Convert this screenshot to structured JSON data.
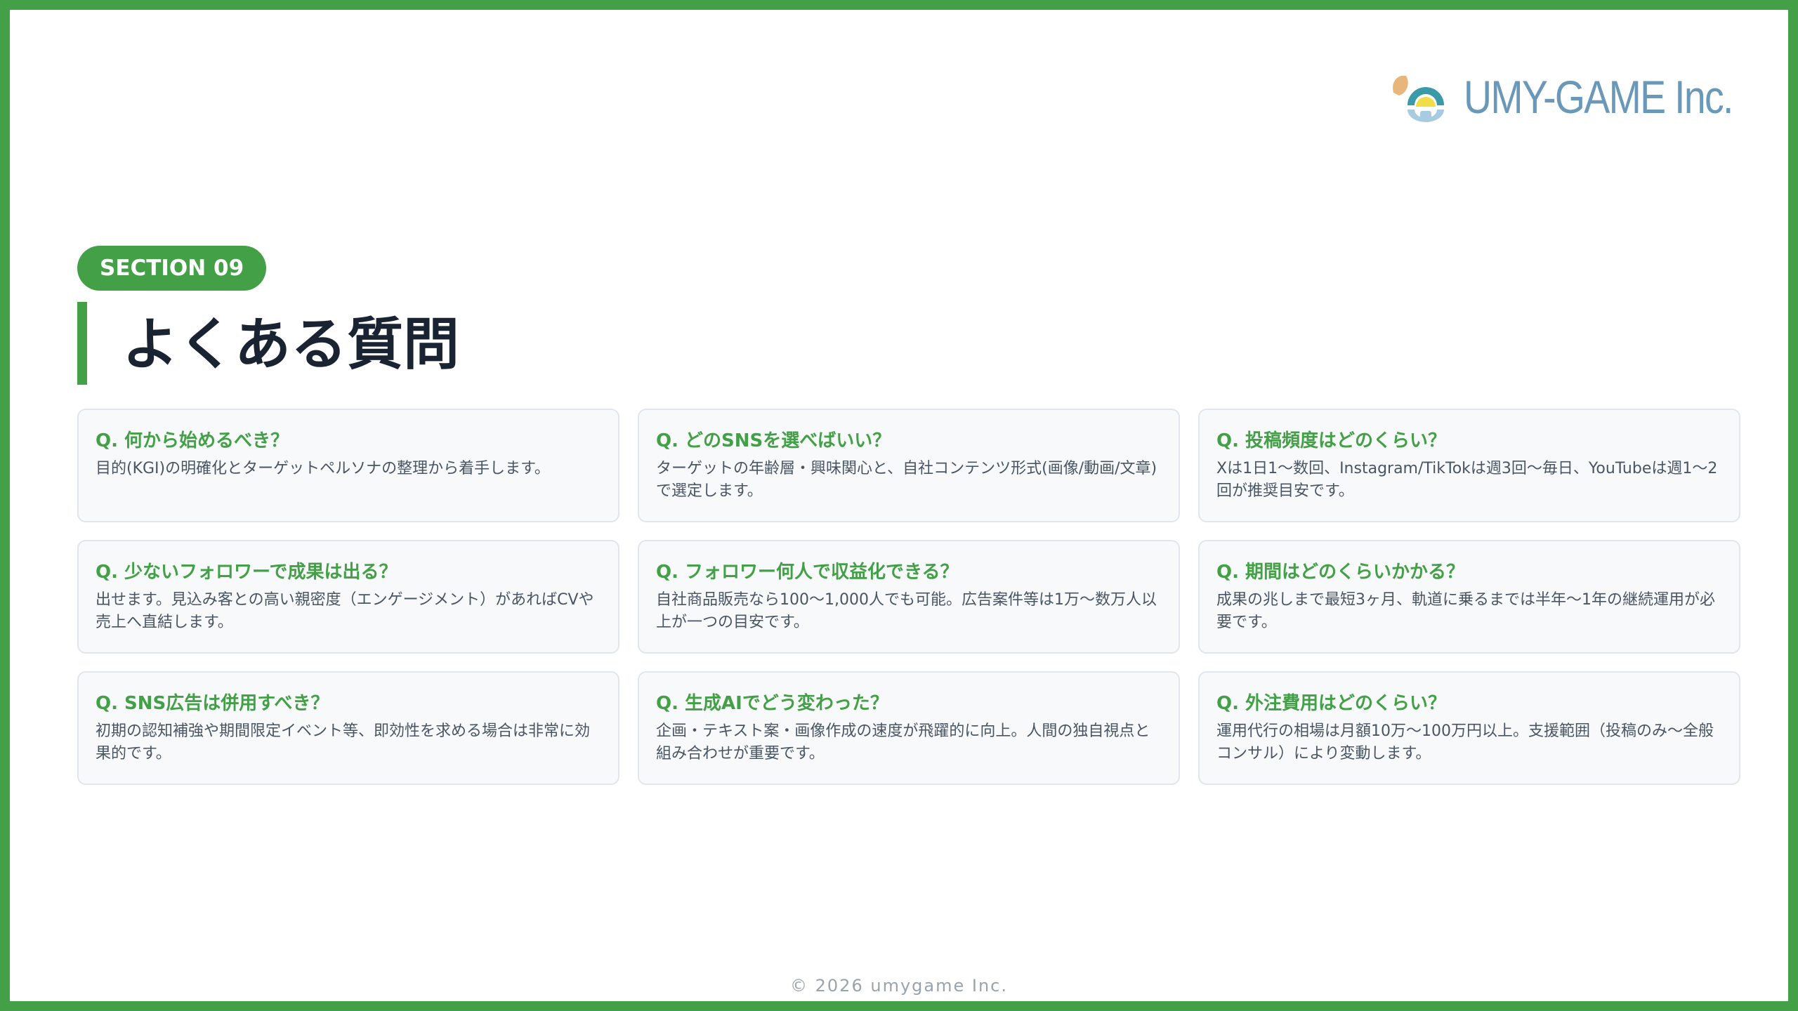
{
  "brand": {
    "logo_icon": "umy-game-logo-icon",
    "logo_text": "UMY-GAME Inc.",
    "colors": {
      "accent": "#43a047",
      "logo_text": "#6a98b8",
      "logo_peach": "#e8b57a",
      "logo_yellow": "#f2dc4a",
      "logo_teal": "#3a9aa8",
      "logo_blue": "#a9cbe2"
    }
  },
  "section": {
    "badge": "SECTION 09",
    "title": "よくある質問"
  },
  "faq": [
    {
      "q": "Q. 何から始めるべき？",
      "a": "目的(KGI)の明確化とターゲットペルソナの整理から着手します。"
    },
    {
      "q": "Q. どのSNSを選べばいい？",
      "a": "ターゲットの年齢層・興味関心と、自社コンテンツ形式(画像/動画/文章)で選定します。"
    },
    {
      "q": "Q. 投稿頻度はどのくらい？",
      "a": "Xは1日1〜数回、Instagram/TikTokは週3回〜毎日、YouTubeは週1〜2回が推奨目安です。"
    },
    {
      "q": "Q. 少ないフォロワーで成果は出る？",
      "a": "出せます。見込み客との高い親密度（エンゲージメント）があればCVや売上へ直結します。"
    },
    {
      "q": "Q. フォロワー何人で収益化できる？",
      "a": "自社商品販売なら100〜1,000人でも可能。広告案件等は1万〜数万人以上が一つの目安です。"
    },
    {
      "q": "Q. 期間はどのくらいかかる？",
      "a": "成果の兆しまで最短3ヶ月、軌道に乗るまでは半年〜1年の継続運用が必要です。"
    },
    {
      "q": "Q. SNS広告は併用すべき？",
      "a": "初期の認知補強や期間限定イベント等、即効性を求める場合は非常に効果的です。"
    },
    {
      "q": "Q. 生成AIでどう変わった？",
      "a": "企画・テキスト案・画像作成の速度が飛躍的に向上。人間の独自視点と組み合わせが重要です。"
    },
    {
      "q": "Q. 外注費用はどのくらい？",
      "a": "運用代行の相場は月額10万〜100万円以上。支援範囲（投稿のみ〜全般コンサル）により変動します。"
    }
  ],
  "footer": {
    "copyright": "© 2026 umygame Inc."
  }
}
